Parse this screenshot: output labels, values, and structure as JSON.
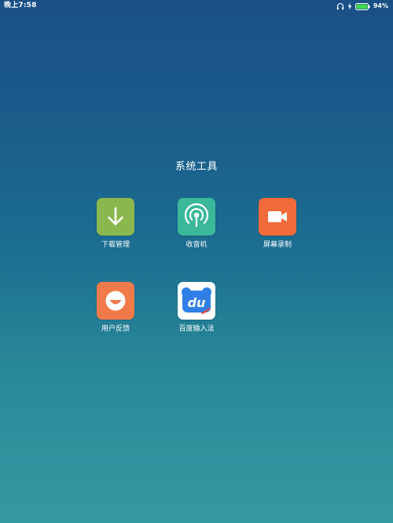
{
  "status_bar": {
    "time": "晚上7:58",
    "battery_percent": "94%",
    "battery_level": 0.94,
    "icons": [
      "headphones-icon",
      "charging-bolt-icon",
      "battery-icon"
    ],
    "battery_color": "#3ddc4a"
  },
  "folder": {
    "title": "系统工具",
    "apps": [
      {
        "label": "下载管理",
        "icon": "download-arrow-icon",
        "color": "#8ab84e"
      },
      {
        "label": "收音机",
        "icon": "radio-signal-icon",
        "color": "#3bb89a"
      },
      {
        "label": "屏幕录制",
        "icon": "video-camera-icon",
        "color": "#f06a3a"
      },
      {
        "label": "用户反馈",
        "icon": "smiley-icon",
        "color": "#f07a4a"
      },
      {
        "label": "百度输入法",
        "icon": "baidu-du-icon",
        "icon_text": "du",
        "color": "#2f7fe6"
      }
    ]
  }
}
